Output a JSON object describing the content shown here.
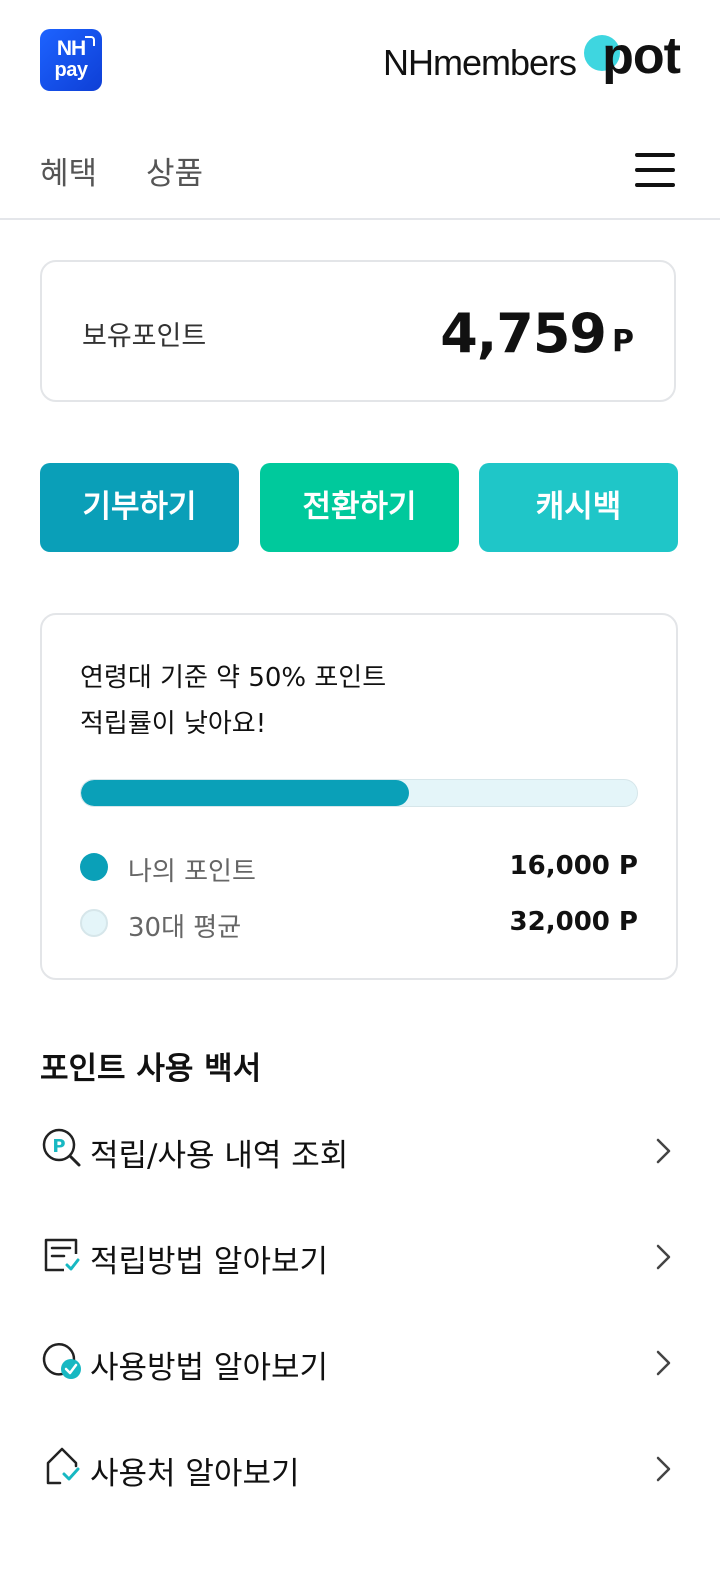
{
  "header": {
    "pay_logo_line1": "NH",
    "pay_logo_line2": "pay",
    "brand_members": "NHmembers",
    "brand_pot": "pot"
  },
  "nav": {
    "tabs": [
      {
        "label": "혜택"
      },
      {
        "label": "상품"
      }
    ]
  },
  "points": {
    "label": "보유포인트",
    "value": "4,759",
    "unit": "P"
  },
  "actions": [
    {
      "label": "기부하기",
      "color": "#0a9fb8"
    },
    {
      "label": "전환하기",
      "color": "#00c99c"
    },
    {
      "label": "캐시백",
      "color": "#1fc6c8"
    }
  ],
  "comparison": {
    "title_line1": "연령대 기준 약 50% 포인트",
    "title_line2": "적립률이 낮아요!",
    "progress_fraction": 0.59,
    "my_points_label": "나의 포인트",
    "my_points_value": "16,000 P",
    "avg_label": "30대 평균",
    "avg_value": "32,000 P",
    "accent_color": "#0aa0b8"
  },
  "guide": {
    "title": "포인트 사용 백서",
    "items": [
      {
        "label": "적립/사용 내역 조회",
        "icon": "point-search-icon"
      },
      {
        "label": "적립방법 알아보기",
        "icon": "checklist-icon"
      },
      {
        "label": "사용방법 알아보기",
        "icon": "circle-check-icon"
      },
      {
        "label": "사용처 알아보기",
        "icon": "house-check-icon"
      }
    ]
  }
}
